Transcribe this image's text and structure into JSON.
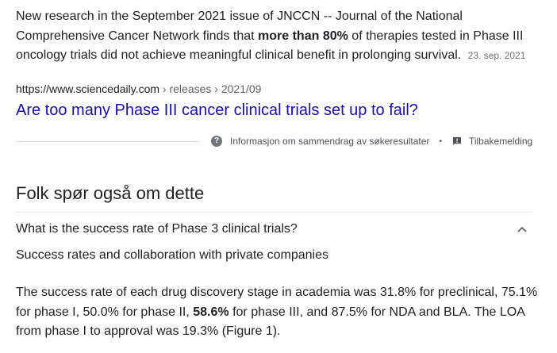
{
  "snippet": {
    "part1": "New research in the September 2021 issue of JNCCN -- Journal of the National Comprehensive Cancer Network finds that ",
    "bold": "more than 80%",
    "part2": " of therapies tested in Phase III oncology trials did not achieve meaningful clinical benefit in prolonging survival.",
    "date": "23. sep. 2021"
  },
  "result": {
    "domain": "https://www.sciencedaily.com",
    "path": " › releases › 2021/09",
    "title": "Are too many Phase III cancer clinical trials set up to fail?"
  },
  "about_row": {
    "info_label": "Informasjon om sammendrag av søkeresultater",
    "separator": "•",
    "feedback_label": "Tilbakemelding"
  },
  "people_also_ask": {
    "heading": "Folk spør også om dette",
    "question": "What is the success rate of Phase 3 clinical trials?",
    "answer_heading": "Success rates and collaboration with private companies",
    "answer_part1": "The success rate of each drug discovery stage in academia was 31.8% for preclinical, 75.1% for phase I, 50.0% for phase II, ",
    "answer_bold": "58.6%",
    "answer_part2": " for phase III, and 87.5% for NDA and BLA. The LOA from phase I to approval was 19.3% (Figure 1)."
  },
  "icons": {
    "info": "question-circle-icon",
    "feedback": "feedback-icon",
    "chevron": "chevron-up-icon"
  },
  "colors": {
    "link": "#1a0dab",
    "text": "#202124",
    "muted": "#70757a"
  }
}
